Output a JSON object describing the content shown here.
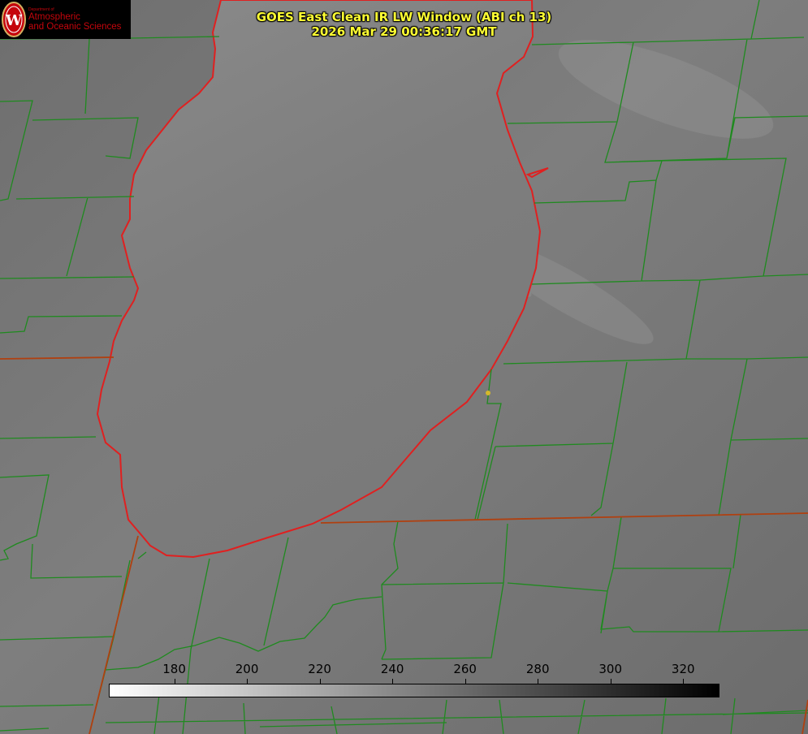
{
  "title": {
    "line1": "GOES East Clean IR LW Window (ABI ch 13)",
    "line2": "2026 Mar 29 00:36:17 GMT"
  },
  "logo": {
    "dept": "Department of",
    "line1": "Atmospheric",
    "line2": "and Oceanic Sciences",
    "seal_letter": "W"
  },
  "colorbar": {
    "ticks": [
      "180",
      "200",
      "220",
      "240",
      "260",
      "280",
      "300",
      "320"
    ],
    "tick_values": [
      180,
      200,
      220,
      240,
      260,
      280,
      300,
      320
    ],
    "range": [
      162,
      330
    ],
    "gradient": [
      "#ffffff",
      "#000000"
    ]
  },
  "colors": {
    "background": "#777777",
    "lake": "#7c7c7c",
    "lake_shore": "#e02020",
    "county_lines": "#1f8a1f",
    "state_lines": "#b04010",
    "title_text": "#ffff33",
    "marker": "#d4b82a"
  }
}
